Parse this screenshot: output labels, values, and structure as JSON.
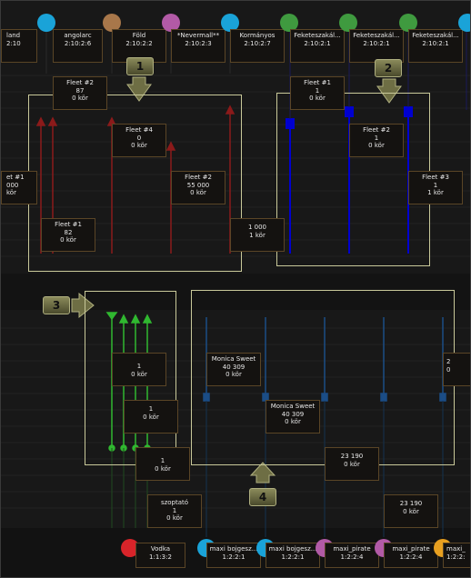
{
  "colors": {
    "gold_border": "#5a4526",
    "frame": "#c9c99a",
    "red": "#8b1a1a",
    "blue": "#0000d0",
    "green": "#30b830",
    "dark_blue": "#1b4d86",
    "marker_olive": "#6e6e44"
  },
  "top_nodes": [
    {
      "name": "land",
      "time": "2:10",
      "color": null
    },
    {
      "name": "angolarc",
      "time": "2:10:2:6",
      "color": "#1aa3d8"
    },
    {
      "name": "Föld",
      "time": "2:10:2:2",
      "color": "#a8774a"
    },
    {
      "name": "*Nevermall**",
      "time": "2:10:2:3",
      "color": "#b25aa6"
    },
    {
      "name": "Kormányos",
      "time": "2:10:2:7",
      "color": "#1aa3d8"
    },
    {
      "name": "Feketeszakál...",
      "time": "2:10:2:1",
      "color": "#3f9a3f"
    },
    {
      "name": "Feketeszakál...",
      "time": "2:10:2:1",
      "color": "#3f9a3f"
    },
    {
      "name": "Feketeszakál...",
      "time": "2:10:2:1",
      "color": "#3f9a3f"
    }
  ],
  "group1_boxes": [
    {
      "title": "Fleet #2",
      "val": "87",
      "sub": "0 kör"
    },
    {
      "title": "Fleet #4",
      "val": "0",
      "sub": "0 kör"
    },
    {
      "title": "Fleet #2",
      "val": "55 000",
      "sub": "0 kör"
    },
    {
      "title": "Fleet #1",
      "val": "82",
      "sub": "0 kör"
    },
    {
      "title": "et #1",
      "val": "000",
      "sub": "kör"
    },
    {
      "title": "",
      "val": "1 000",
      "sub": "1 kör"
    }
  ],
  "group2_boxes": [
    {
      "title": "Fleet #1",
      "val": "1",
      "sub": "0 kör"
    },
    {
      "title": "Fleet #2",
      "val": "1",
      "sub": "0 kör"
    },
    {
      "title": "Fleet #3",
      "val": "1",
      "sub": "1 kör"
    }
  ],
  "group3_boxes": [
    {
      "title": "",
      "val": "1",
      "sub": "0 kör"
    },
    {
      "title": "",
      "val": "1",
      "sub": "0 kör"
    },
    {
      "title": "",
      "val": "1",
      "sub": "0 kör"
    },
    {
      "title": "",
      "val": "szoptató",
      "sub": "1",
      "sub2": "0 kör"
    }
  ],
  "group4_boxes": [
    {
      "title": "Monica Sweet",
      "val": "40 309",
      "sub": "0 kör"
    },
    {
      "title": "Monica Sweet",
      "val": "40 309",
      "sub": "0 kör"
    },
    {
      "title": "",
      "val": "23 190",
      "sub": "0 kör"
    },
    {
      "title": "",
      "val": "23 190",
      "sub": "0 kör"
    },
    {
      "title": "",
      "val": "2",
      "sub": "0"
    }
  ],
  "markers": [
    "1",
    "2",
    "3",
    "4"
  ],
  "bottom_nodes": [
    {
      "name": "Vodka",
      "time": "1:1:3:2",
      "color": "#d8242a"
    },
    {
      "name": "maxi bojgesz...",
      "time": "1:2:2:1",
      "color": "#1aa3d8"
    },
    {
      "name": "maxi bojgesz...",
      "time": "1:2:2:1",
      "color": "#1aa3d8"
    },
    {
      "name": "maxi_pirate",
      "time": "1:2:2:4",
      "color": "#b25aa6"
    },
    {
      "name": "maxi_pirate",
      "time": "1:2:2:4",
      "color": "#b25aa6"
    },
    {
      "name": "maxi_",
      "time": "1:2:2:",
      "color": "#e8a020"
    }
  ]
}
